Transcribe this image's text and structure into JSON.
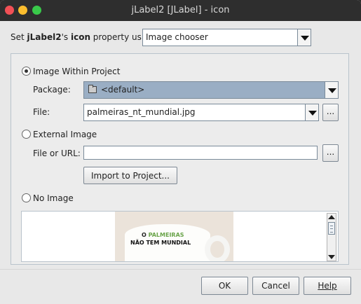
{
  "window": {
    "title": "jLabel2 [JLabel] - icon"
  },
  "header": {
    "prefix": "Set ",
    "component": "jLabel2",
    "possessive": "'s ",
    "property": "icon",
    "suffix": " property using:",
    "chooser_value": "Image chooser"
  },
  "options": {
    "within_project": {
      "label": "Image Within Project",
      "selected": true,
      "package_label": "Package:",
      "package_value": "<default>",
      "file_label": "File:",
      "file_value": "palmeiras_nt_mundial.jpg",
      "browse_label": "..."
    },
    "external": {
      "label": "External Image",
      "selected": false,
      "file_or_url_label": "File or URL:",
      "file_or_url_value": "",
      "browse_label": "...",
      "import_label": "Import to Project..."
    },
    "no_image": {
      "label": "No Image",
      "selected": false
    }
  },
  "preview": {
    "mug_text_line1_a": "O ",
    "mug_text_line1_b": "PALMEIRAS",
    "mug_text_line2": "NÃO TEM MUNDIAL"
  },
  "footer": {
    "ok_label": "OK",
    "cancel_label": "Cancel",
    "help_label": "Help"
  },
  "colors": {
    "titlebar": "#2e2e2e",
    "selected_combo": "#9aaec4",
    "dialog_bg": "#e8e8e8"
  }
}
